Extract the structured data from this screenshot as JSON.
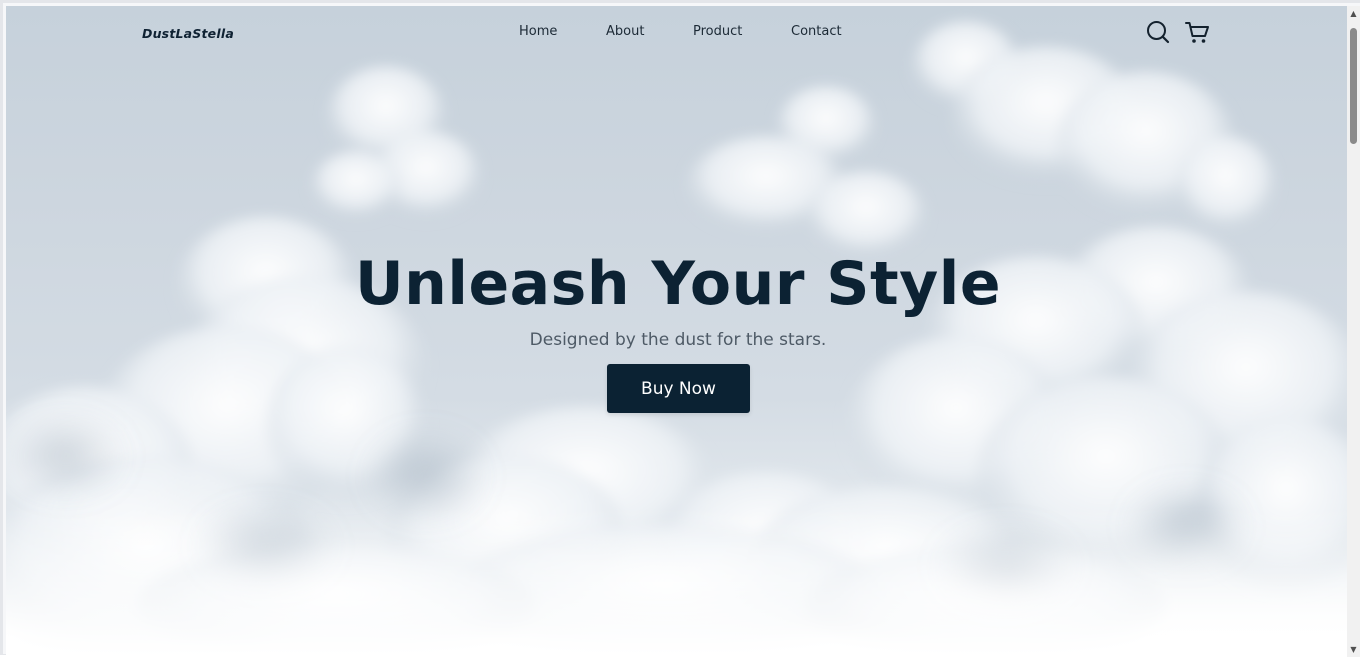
{
  "brand": {
    "name": "DustLaStella"
  },
  "nav": {
    "items": [
      {
        "label": "Home"
      },
      {
        "label": "About"
      },
      {
        "label": "Product"
      },
      {
        "label": "Contact"
      }
    ]
  },
  "header_icons": {
    "search": "search-icon",
    "cart": "cart-icon"
  },
  "hero": {
    "headline": "Unleash Your Style",
    "subline": "Designed by the dust for the stars.",
    "cta_label": "Buy Now"
  },
  "colors": {
    "primary": "#0b2233",
    "text_dark": "#0c2233",
    "subtext": "#4e5a66",
    "sky": "#c6d1db"
  }
}
